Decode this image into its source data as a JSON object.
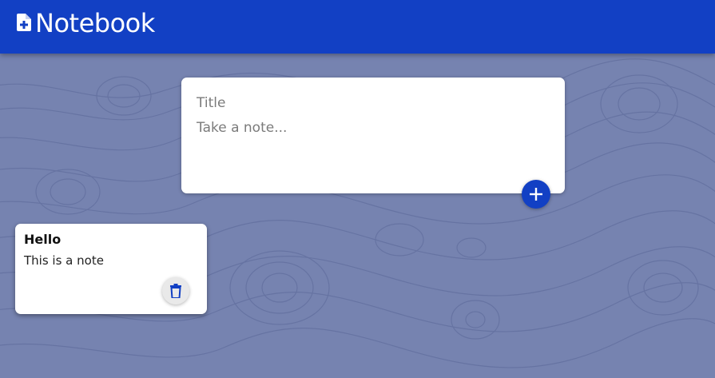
{
  "header": {
    "title": "Notebook",
    "brand_color": "#1240c4",
    "icon": "note-add-icon"
  },
  "composer": {
    "title_placeholder": "Title",
    "content_placeholder": "Take a note...",
    "title_value": "",
    "content_value": "",
    "add_icon": "plus-icon"
  },
  "notes": [
    {
      "title": "Hello",
      "content": "This is a note",
      "delete_icon": "trash-icon"
    }
  ],
  "colors": {
    "background": "#7683b0",
    "accent": "#1240c4",
    "card": "#ffffff"
  }
}
